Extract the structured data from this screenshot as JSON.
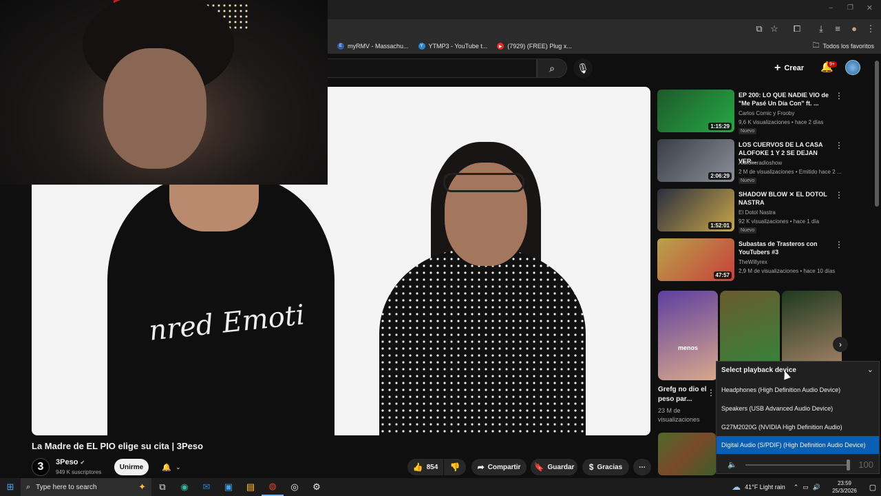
{
  "bookmarks": {
    "items": [
      {
        "label": "myRMV - Massachu...",
        "color": "#2f5fa8",
        "glyph": "E"
      },
      {
        "label": "YTMP3 - YouTube t...",
        "color": "#2b87d8",
        "glyph": "Y"
      },
      {
        "label": "(7929) (FREE) Plug x...",
        "color": "#e52d27",
        "glyph": "▶"
      }
    ],
    "all_label": "Todos los favoritos"
  },
  "header": {
    "create_label": "Crear",
    "notif_badge": "9+"
  },
  "video": {
    "title": "La Madre de EL PIO elige su cita | 3Peso",
    "shirt_text": "nred Emoti",
    "channel": {
      "initial": "3",
      "name": "3Peso",
      "subs": "949 K suscriptores"
    },
    "join_label": "Unirme",
    "likes": "854",
    "share_label": "Compartir",
    "save_label": "Guardar",
    "thanks_label": "Gracias"
  },
  "recommendations": [
    {
      "title": "EP 200: LO QUE NADIE VIO de \"Me Pasé Un Día Con\" ft. ...",
      "channel": "Carlos Comic y Frooby",
      "meta": "9,6 K visualizaciones • hace 2 días",
      "duration": "1:15:29",
      "badge": "Nuevo",
      "thumb": "#1e5a2a",
      "thumb2": "#26a845"
    },
    {
      "title": "LOS CUERVOS DE LA CASA ALOFOKE 1 Y 2 SE DEJAN VER...",
      "channel": "Alofokeradioshow",
      "meta": "2 M de visualizaciones • Emitido hace 2 ...",
      "duration": "2:06:29",
      "badge": "Nuevo",
      "thumb": "#3a3d44",
      "thumb2": "#8a8f99"
    },
    {
      "title": "SHADOW BLOW ✕ EL DOTOL NASTRA",
      "channel": "El Dotol Nastra",
      "meta": "92 K visualizaciones • hace 1 día",
      "duration": "1:52:01",
      "badge": "Nuevo",
      "thumb": "#2a2f3e",
      "thumb2": "#c9a64a"
    },
    {
      "title": "Subastas de Trasteros con YouTubers #3",
      "channel": "TheWillyrex",
      "meta": "2,9 M de visualizaciones • hace 10 días",
      "duration": "47:57",
      "badge": "",
      "thumb": "#b9a24a",
      "thumb2": "#c8403a"
    }
  ],
  "shorts": {
    "items": [
      {
        "caption": "menos",
        "color": "#5e3fa0",
        "color2": "#d8a88c"
      },
      {
        "caption": "",
        "color": "#6a5a30",
        "color2": "#2e8a3a"
      },
      {
        "caption": "",
        "color": "#1e3a1e",
        "color2": "#b48a70"
      }
    ],
    "first_title": "Grefg no dio el peso par...",
    "first_views": "23 M de visualizaciones"
  },
  "playback": {
    "title": "Select playback device",
    "devices": [
      "Headphones (High Definition Audio Device)",
      "Speakers (USB Advanced Audio Device)",
      "G27M2020G (NVIDIA High Definition Audio)",
      "Digital Audio (S/PDIF) (High Definition Audio Device)"
    ],
    "selected_index": 3,
    "volume_value": "100",
    "volume_level": 1.0
  },
  "taskbar": {
    "search_placeholder": "Type here to search",
    "weather": "41°F  Light rain",
    "time": "23:59",
    "date": "25/3/2026"
  },
  "colors": {
    "accent": "#cc0000",
    "selected": "#0a5fb2"
  }
}
